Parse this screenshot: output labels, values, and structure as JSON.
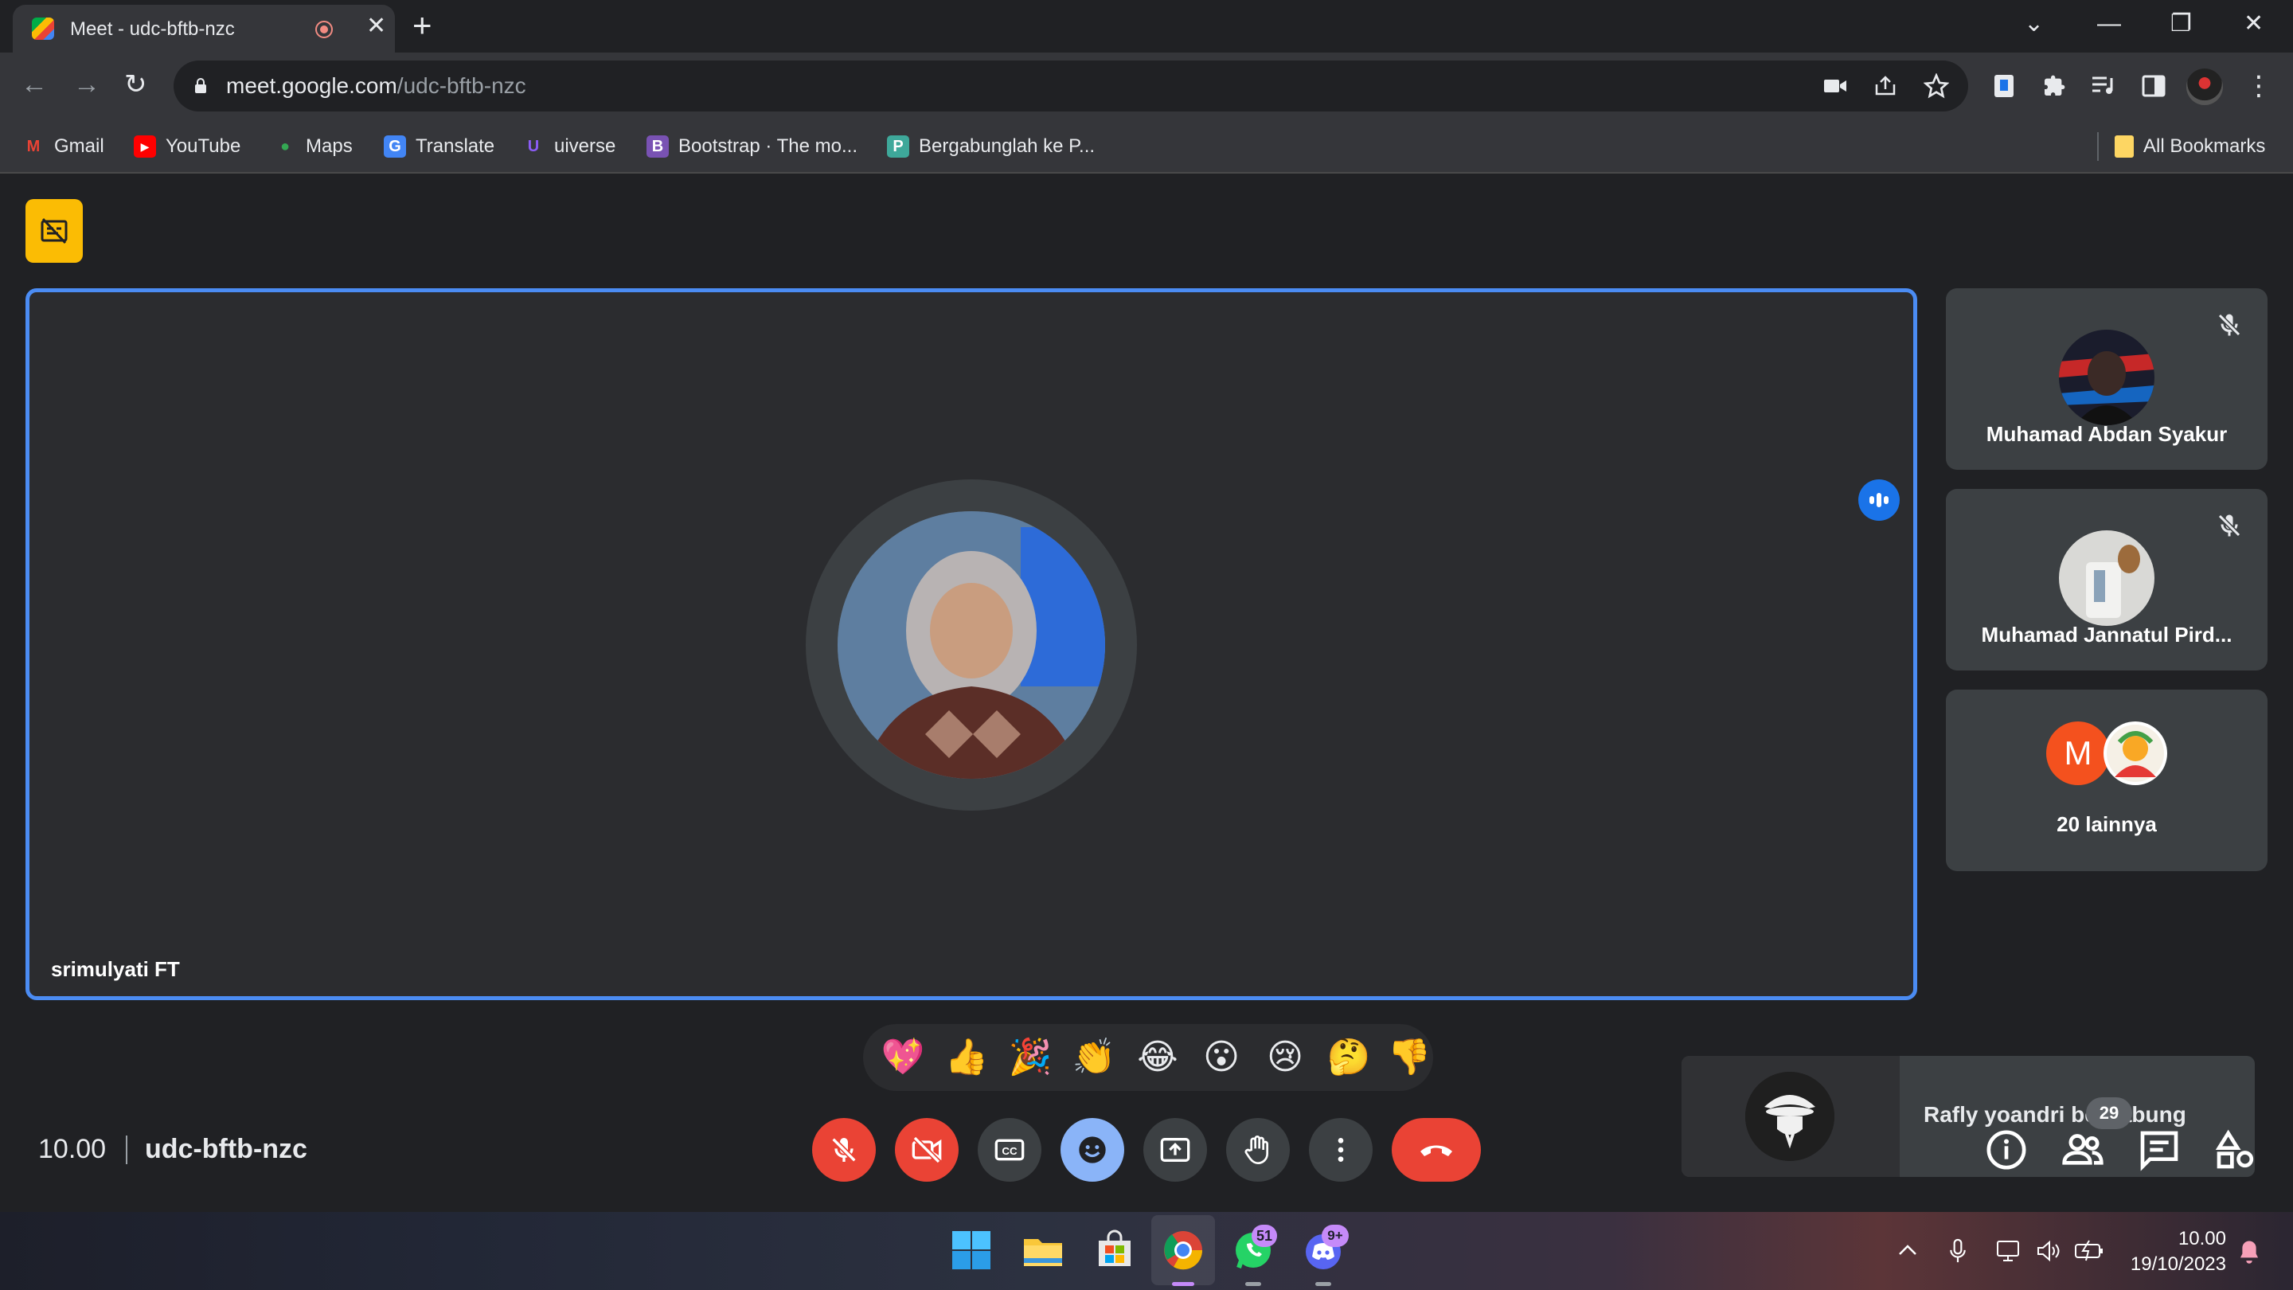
{
  "browser": {
    "tab_title": "Meet - udc-bftb-nzc",
    "tab_close": "✕",
    "new_tab": "+",
    "window_controls": {
      "tab_search": "⌄",
      "minimize": "—",
      "restore": "❐",
      "close": "✕"
    },
    "nav": {
      "back": "←",
      "forward": "→",
      "reload": "↻"
    },
    "url_host": "meet.google.com",
    "url_path": "/udc-bftb-nzc",
    "bookmarks": [
      {
        "label": "Gmail",
        "icon": "gmail-icon",
        "glyph": "M",
        "color": "#ea4335"
      },
      {
        "label": "YouTube",
        "icon": "youtube-icon",
        "glyph": "▶",
        "color": "#ff0000"
      },
      {
        "label": "Maps",
        "icon": "maps-icon",
        "glyph": "●",
        "color": "#34a853"
      },
      {
        "label": "Translate",
        "icon": "translate-icon",
        "glyph": "G",
        "color": "#4285f4"
      },
      {
        "label": "uiverse",
        "icon": "uiverse-icon",
        "glyph": "U",
        "color": "#6d28d9"
      },
      {
        "label": "Bootstrap · The mo...",
        "icon": "bootstrap-icon",
        "glyph": "B",
        "color": "#7952b3"
      },
      {
        "label": "Bergabunglah ke P...",
        "icon": "page-icon",
        "glyph": "P",
        "color": "#3ea89a"
      }
    ],
    "all_bookmarks": "All Bookmarks"
  },
  "meet": {
    "main_speaker": {
      "name": "srimulyati FT"
    },
    "participants": [
      {
        "name": "Muhamad Abdan Syakur",
        "muted": true
      },
      {
        "name": "Muhamad Jannatul Pird...",
        "muted": true
      }
    ],
    "others": {
      "label": "20 lainnya",
      "avatar_letter": "M",
      "avatar_color": "#f4511e"
    },
    "toast": {
      "text": "Rafly yoandri bergabung"
    },
    "reactions": [
      "💖",
      "👍",
      "🎉",
      "👏",
      "😂",
      "😮",
      "😢",
      "🤔",
      "👎"
    ],
    "clock": "10.00",
    "meeting_code": "udc-bftb-nzc",
    "people_count": "29",
    "colors": {
      "accent": "#8ab4f8",
      "danger": "#ea4335",
      "speaking_border": "#4b8cf3",
      "badge": "#fbbc04"
    }
  },
  "taskbar": {
    "time": "10.00",
    "date": "19/10/2023",
    "whatsapp_badge": "51",
    "discord_badge": "9+"
  }
}
